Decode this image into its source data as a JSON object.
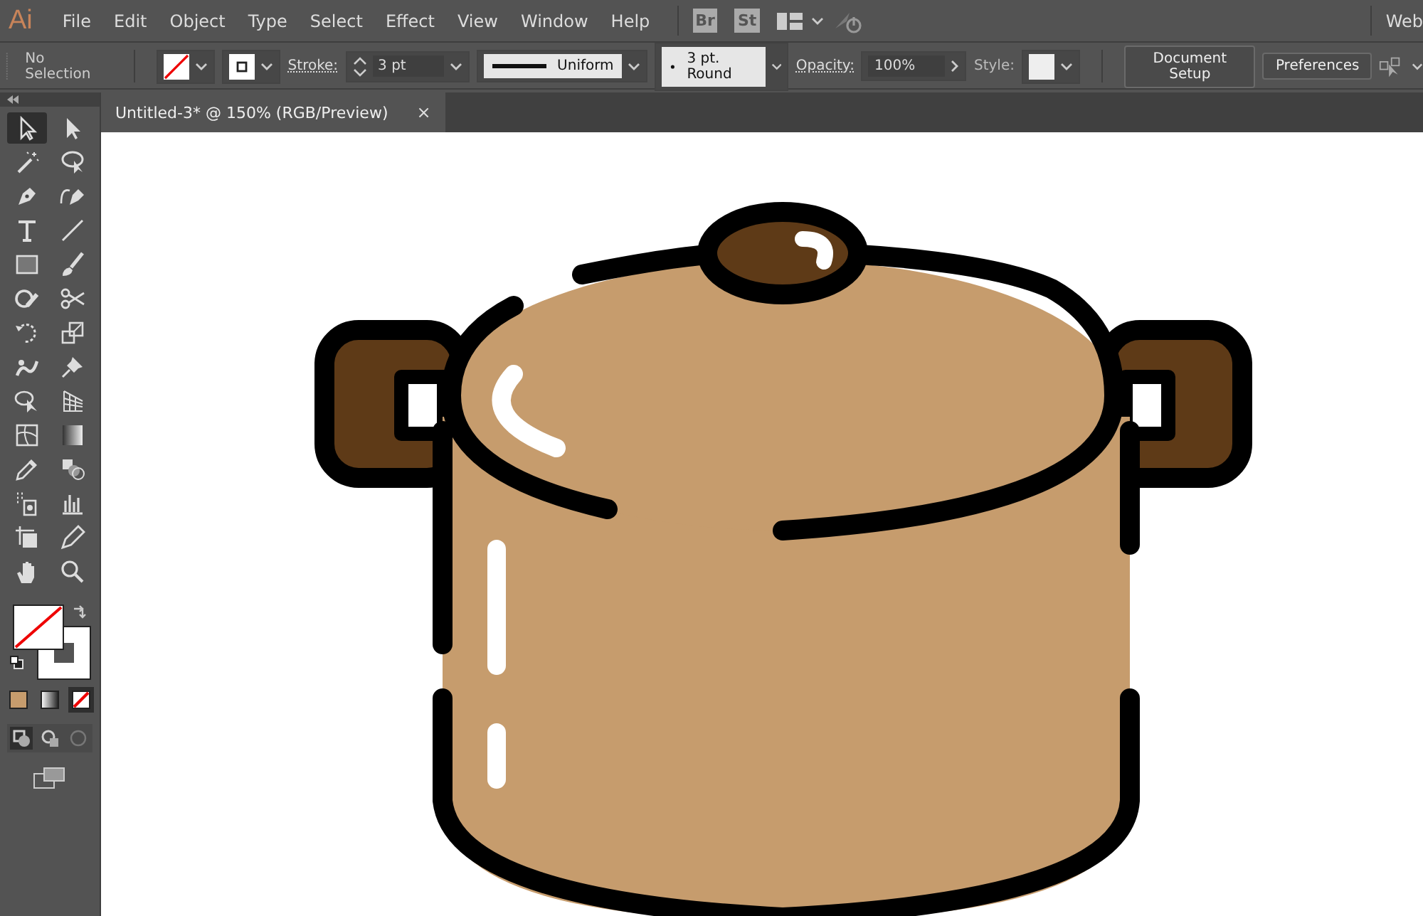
{
  "menu_bar": {
    "app_logo": "Ai",
    "items": [
      "File",
      "Edit",
      "Object",
      "Type",
      "Select",
      "Effect",
      "View",
      "Window",
      "Help"
    ],
    "bridge": "Br",
    "stock": "St",
    "workspace": "Web"
  },
  "control_bar": {
    "selection": "No Selection",
    "stroke_label": "Stroke:",
    "stroke_weight": "3 pt",
    "profile": "Uniform",
    "brush": "3 pt. Round",
    "opacity_label": "Opacity:",
    "opacity": "100%",
    "style_label": "Style:",
    "buttons": [
      "Document Setup",
      "Preferences"
    ]
  },
  "document_tab": {
    "title": "Untitled-3* @ 150% (RGB/Preview)",
    "close": "×"
  },
  "tools": [
    {
      "kind": "selection",
      "selected": true
    },
    {
      "kind": "direct",
      "selected": false
    },
    {
      "kind": "wand",
      "selected": false
    },
    {
      "kind": "lasso",
      "selected": false
    },
    {
      "kind": "pen",
      "selected": false
    },
    {
      "kind": "curvature",
      "selected": false
    },
    {
      "kind": "type",
      "selected": false
    },
    {
      "kind": "line",
      "selected": false
    },
    {
      "kind": "rectangle",
      "selected": false
    },
    {
      "kind": "brush",
      "selected": false
    },
    {
      "kind": "shaper",
      "selected": false
    },
    {
      "kind": "scissors",
      "selected": false
    },
    {
      "kind": "rotate",
      "selected": false
    },
    {
      "kind": "scale",
      "selected": false
    },
    {
      "kind": "warp",
      "selected": false
    },
    {
      "kind": "pin",
      "selected": false
    },
    {
      "kind": "shapebuilder",
      "selected": false
    },
    {
      "kind": "perspective",
      "selected": false
    },
    {
      "kind": "mesh",
      "selected": false
    },
    {
      "kind": "gradient",
      "selected": false
    },
    {
      "kind": "eyedropper",
      "selected": false
    },
    {
      "kind": "blend",
      "selected": false
    },
    {
      "kind": "sprayer",
      "selected": false
    },
    {
      "kind": "graph",
      "selected": false
    },
    {
      "kind": "artboard",
      "selected": false
    },
    {
      "kind": "pencil",
      "selected": false
    },
    {
      "kind": "hand",
      "selected": false
    },
    {
      "kind": "zoom",
      "selected": false
    }
  ],
  "color_modes": [
    {
      "kind": "color",
      "selected": false
    },
    {
      "kind": "gradient",
      "selected": false
    },
    {
      "kind": "none",
      "selected": true
    }
  ]
}
